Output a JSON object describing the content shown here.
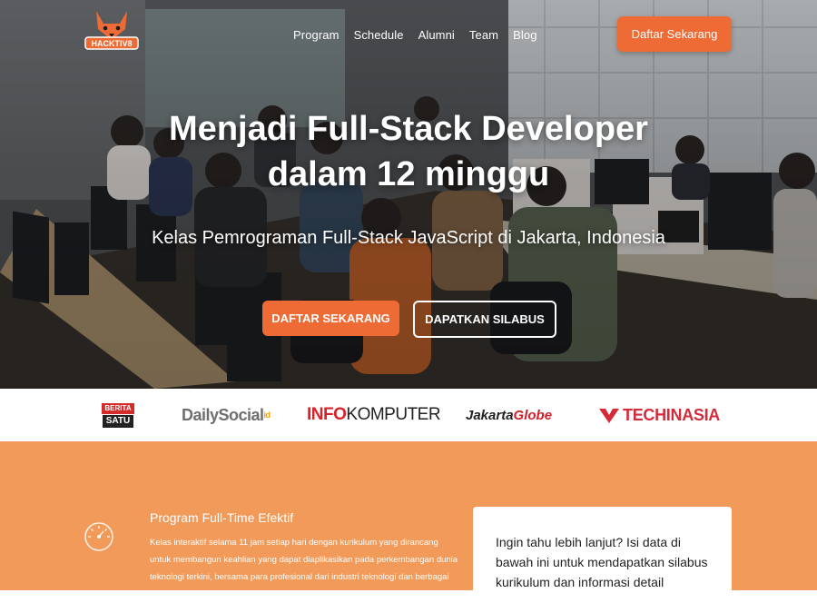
{
  "brand": {
    "logo_text": "HACKTIV8"
  },
  "nav": {
    "items": [
      "Program",
      "Schedule",
      "Alumni",
      "Team",
      "Blog"
    ],
    "cta_label": "Daftar Sekarang"
  },
  "hero": {
    "title_line1": "Menjadi Full-Stack Developer",
    "title_line2": "dalam 12 minggu",
    "subtitle": "Kelas Pemrograman Full-Stack JavaScript di Jakarta, Indonesia",
    "primary_button": "DAFTAR SEKARANG",
    "secondary_button": "DAPATKAN SILABUS"
  },
  "press": {
    "berita_top": "BERITA",
    "berita_bottom": "SATU",
    "dailysocial": "DailySocial",
    "dailysocial_suffix": "id",
    "infokomputer_a": "INFO",
    "infokomputer_b": "KOMPUTER",
    "jakarta_a": "Jakarta",
    "jakarta_b": "Globe",
    "techinasia": "TECHINASIA"
  },
  "feature": {
    "title": "Program Full-Time Efektif",
    "description": "Kelas interaktif selama 11 jam setiap hari dengan kurikulum yang dirancang untuk membangun keahlian yang dapat diaplikasikan pada perkembangan dunia teknologi terkini, bersama para profesional dari industri teknologi dan berbagai perusahaan."
  },
  "card": {
    "text": "Ingin tahu lebih lanjut? Isi data di bawah ini untuk mendapatkan silabus kurikulum dan informasi detail"
  },
  "colors": {
    "accent": "#ee6b35",
    "orange_section": "#f29a59",
    "hero_dark": "#2a2f33"
  }
}
